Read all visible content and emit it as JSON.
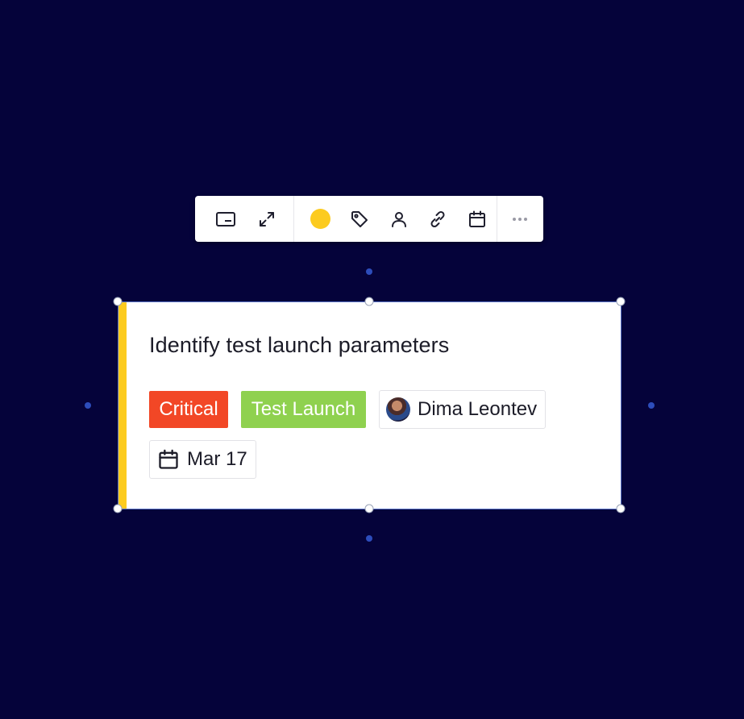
{
  "toolbar": {
    "items": [
      {
        "name": "card-view-icon",
        "label": "Card view"
      },
      {
        "name": "expand-icon",
        "label": "Expand"
      },
      {
        "name": "color-picker",
        "label": "Color"
      },
      {
        "name": "tag-icon",
        "label": "Tag"
      },
      {
        "name": "assignee-icon",
        "label": "Assignee"
      },
      {
        "name": "link-icon",
        "label": "Link"
      },
      {
        "name": "calendar-icon",
        "label": "Date"
      },
      {
        "name": "more-icon",
        "label": "More"
      }
    ],
    "card_color": "#fccb1f"
  },
  "card": {
    "title": "Identify test launch parameters",
    "accent_color": "#fccb1f",
    "tags": [
      {
        "label": "Critical",
        "color": "#f24726"
      },
      {
        "label": "Test Launch",
        "color": "#8fd14f"
      }
    ],
    "assignee": {
      "name": "Dima Leontev",
      "avatar": "avatar"
    },
    "due_date": "Mar 17"
  },
  "canvas": {
    "background": "#05033a"
  }
}
